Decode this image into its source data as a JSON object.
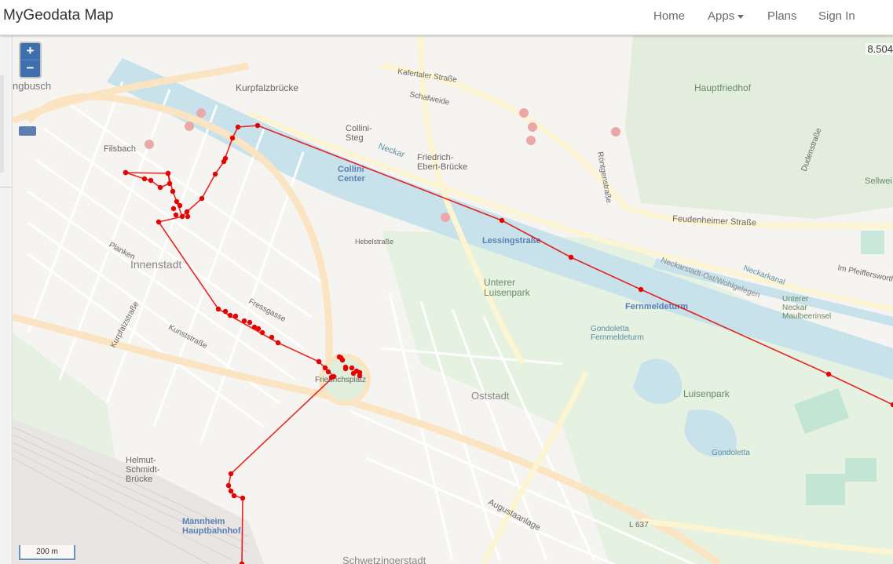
{
  "app": {
    "brand": "MyGeodata Map"
  },
  "nav": {
    "home": "Home",
    "apps": "Apps",
    "plans": "Plans",
    "sign_in": "Sign In"
  },
  "map": {
    "zoom_in": "+",
    "zoom_out": "−",
    "scale": "200 m",
    "coordinate_readout": "8.504",
    "track_color": "#e60000",
    "labels": {
      "jungbusch": "ngbusch",
      "kurpfalzbruecke": "Kurpfalzbrücke",
      "filsbach": "Filsbach",
      "collini_steg": "Collini-\nSteg",
      "collini_center": "Collini\nCenter",
      "friedrich_ebert_bruecke": "Friedrich-\nEbert-Brücke",
      "hauptfriedhof": "Hauptfriedhof",
      "neckar": "Neckar",
      "feudenheimer": "Feudenheimer Straße",
      "lessingstrasse": "Lessingstraße",
      "innenstadt": "Innenstadt",
      "unterer_luisenpark": "Unterer\nLuisenpark",
      "fernmeldeturm": "Fernmeldeturm",
      "gondoletta_fernmeldeturm": "Gondoletta\nFernmeldeturm",
      "luisenpark": "Luisenpark",
      "oststadt": "Oststadt",
      "gondoletta": "Gondoletta",
      "helmut_schmidt_bruecke": "Helmut-\nSchmidt-\nBrücke",
      "mannheim_hbf": "Mannheim\nHauptbahnhof",
      "augustaanlage": "Augustaanlage",
      "neckarkanal": "Neckarkanal",
      "unterer_neckar": "Unterer\nNeckar\nMaulbeerinsel",
      "kunststrasse": "Kunststraße",
      "fressgasse": "Fressgasse",
      "planken": "Planken",
      "kurpfalzstrasse": "Kurpfalzstraße",
      "friedrichsplatz": "Friedrichsplatz",
      "schwetzingerstadt": "Schwetzingerstadt",
      "kaefertaler": "Kafertaler Straße",
      "schafweide": "Schafweide",
      "roentgenstrasse": "Röntgenstraße",
      "dudenstrasse": "Dudenstraße",
      "hebelstrasse": "Hebelstraße",
      "l637": "L 637",
      "sellweide": "Sellwei",
      "neckarstadt_ost": "Neckarstadt-Ost/Wohlgelegen",
      "im_pfeiffersworth": "Im Pfeiffersworth"
    }
  }
}
